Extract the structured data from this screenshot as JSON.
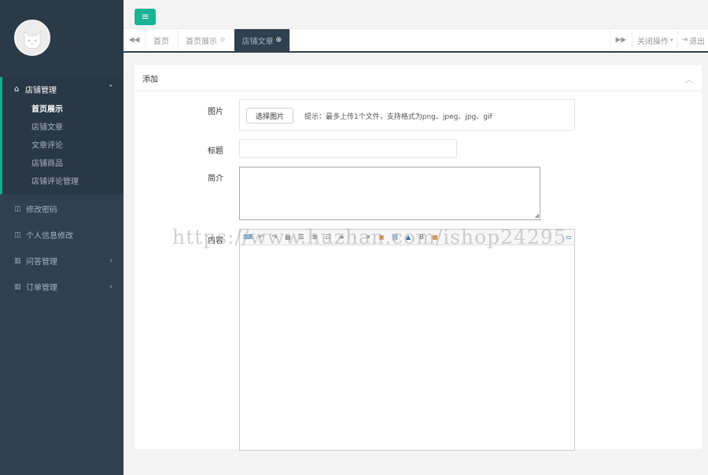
{
  "sidebar": {
    "groups": [
      {
        "label": "店铺管理",
        "icon": "home-icon",
        "arrow": "˅",
        "items": [
          {
            "label": "首页展示"
          },
          {
            "label": "店铺文章"
          },
          {
            "label": "文章评论"
          },
          {
            "label": "店铺商品"
          },
          {
            "label": "店铺评论管理"
          }
        ]
      }
    ],
    "menu": [
      {
        "label": "修改密码",
        "icon": "columns-icon"
      },
      {
        "label": "个人信息修改",
        "icon": "columns-icon"
      },
      {
        "label": "问答管理",
        "icon": "bar-chart-icon",
        "arrow": "‹"
      },
      {
        "label": "订单管理",
        "icon": "bar-chart-icon",
        "arrow": "‹"
      }
    ]
  },
  "topbar": {
    "menu_icon": "≡"
  },
  "tabs": {
    "items": [
      {
        "label": "首页"
      },
      {
        "label": "首页展示"
      },
      {
        "label": "店铺文章"
      }
    ],
    "close_ops": "关闭操作",
    "logout": "退出"
  },
  "panel": {
    "title": "添加",
    "fields": {
      "image_label": "图片",
      "upload_button": "选择图片",
      "upload_hint": "提示：最多上传1个文件，支持格式为png、jpeg、jpg、gif",
      "title_label": "标题",
      "intro_label": "简介",
      "content_label": "内容"
    }
  },
  "watermark": "https://www.huzhan.com/ishop24295",
  "colors": {
    "sidebar_bg": "#2f4050",
    "accent": "#1ab394",
    "active_tab_bg": "#2f4050"
  }
}
